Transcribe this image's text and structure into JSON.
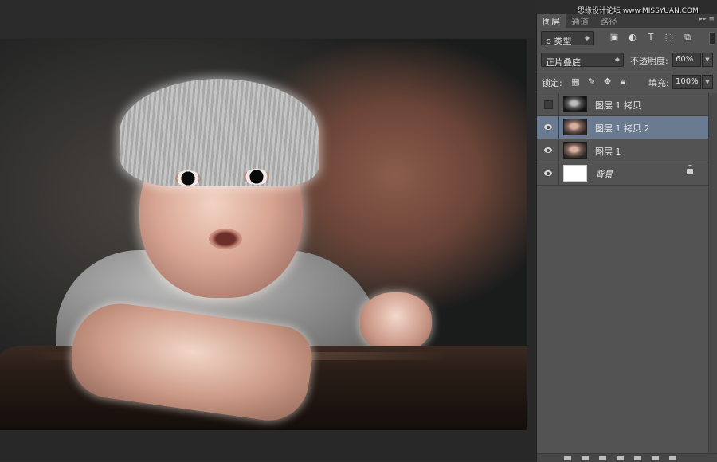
{
  "watermark": "思缘设计论坛 www.MISSYUAN.COM",
  "panel": {
    "tabs": [
      {
        "label": "图层",
        "active": true
      },
      {
        "label": "通道",
        "active": false
      },
      {
        "label": "路径",
        "active": false
      }
    ],
    "tab_menu": "▸▸ ≡",
    "filter": {
      "label": "ρ 类型",
      "icons": [
        "image-filter-icon",
        "adjustment-filter-icon",
        "type-filter-icon",
        "shape-filter-icon",
        "smart-object-filter-icon"
      ]
    },
    "blend_mode": "正片叠底",
    "opacity_label": "不透明度:",
    "opacity_value": "60%",
    "lock_label": "锁定:",
    "fill_label": "填充:",
    "fill_value": "100%",
    "layers": [
      {
        "name": "图层 1 拷贝",
        "visible": false,
        "selected": false,
        "thumb": "baby-dark"
      },
      {
        "name": "图层 1 拷贝 2",
        "visible": true,
        "selected": true,
        "thumb": "baby"
      },
      {
        "name": "图层 1",
        "visible": true,
        "selected": false,
        "thumb": "baby"
      },
      {
        "name": "背景",
        "visible": true,
        "selected": false,
        "thumb": "white",
        "locked": true
      }
    ]
  },
  "colors": {
    "panel_bg": "#535353",
    "selected_layer": "#6a7b91",
    "app_bg": "#2c2c2c"
  }
}
